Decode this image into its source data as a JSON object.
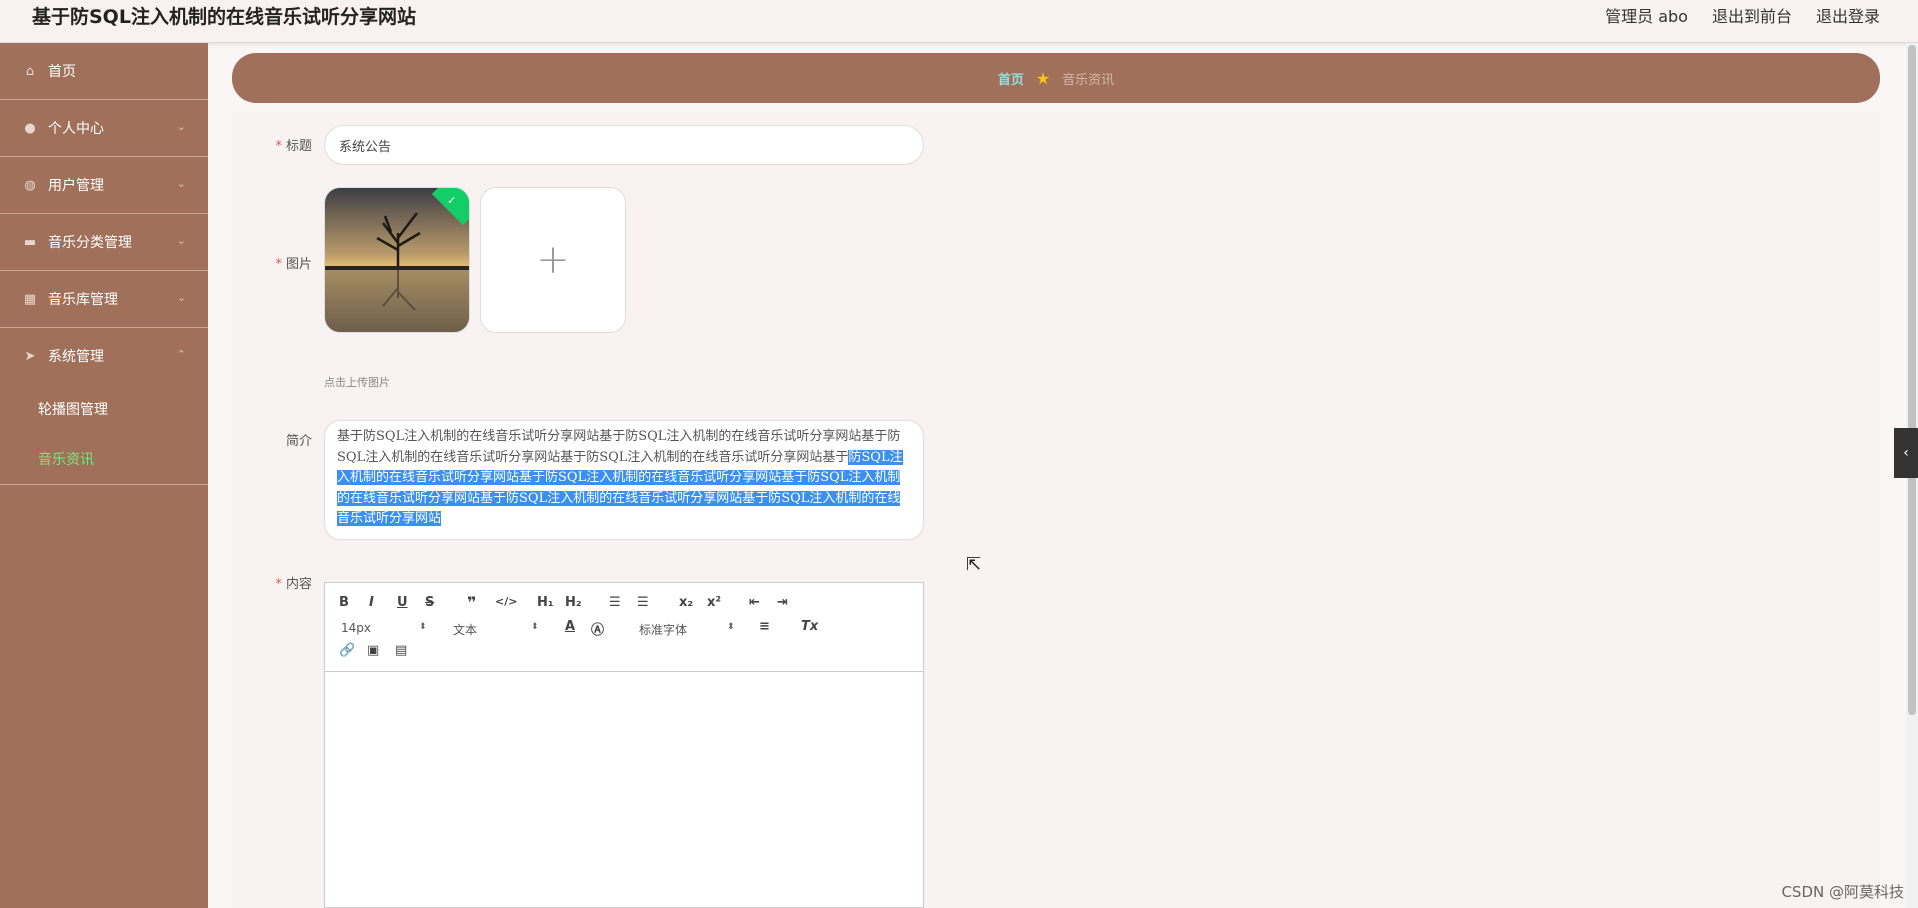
{
  "header": {
    "site_title": "基于防SQL注入机制的在线音乐试听分享网站",
    "admin_label": "管理员 abo",
    "front_label": "退出到前台",
    "logout_label": "退出登录"
  },
  "sidebar": {
    "items": [
      {
        "label": "首页",
        "icon": "home-icon"
      },
      {
        "label": "个人中心",
        "icon": "user-icon"
      },
      {
        "label": "用户管理",
        "icon": "settings-icon"
      },
      {
        "label": "音乐分类管理",
        "icon": "briefcase-icon"
      },
      {
        "label": "音乐库管理",
        "icon": "grid-icon"
      },
      {
        "label": "系统管理",
        "icon": "send-icon"
      }
    ],
    "sub_items": [
      {
        "label": "轮播图管理"
      },
      {
        "label": "音乐资讯",
        "active": true
      }
    ]
  },
  "breadcrumb": {
    "home": "首页",
    "current": "音乐资讯"
  },
  "form": {
    "title_label": "标题",
    "title_value": "系统公告",
    "image_label": "图片",
    "upload_tip": "点击上传图片",
    "intro_label": "简介",
    "intro_plain": "基于防SQL注入机制的在线音乐试听分享网站基于防SQL注入机制的在线音乐试听分享网站基于防SQL注入机制的在线音乐试听分享网站基于防SQL注入机制的在线音乐试听分享网站基于",
    "intro_selected": "防SQL注入机制的在线音乐试听分享网站基于防SQL注入机制的在线音乐试听分享网站基于防SQL注入机制的在线音乐试听分享网站基于防SQL注入机制的在线音乐试听分享网站基于防SQL注入机制的在线音乐试听分享网站",
    "content_label": "内容",
    "editor": {
      "size_value": "14px",
      "header_value": "文本",
      "font_value": "标准字体"
    }
  },
  "watermark": "CSDN @阿莫科技"
}
